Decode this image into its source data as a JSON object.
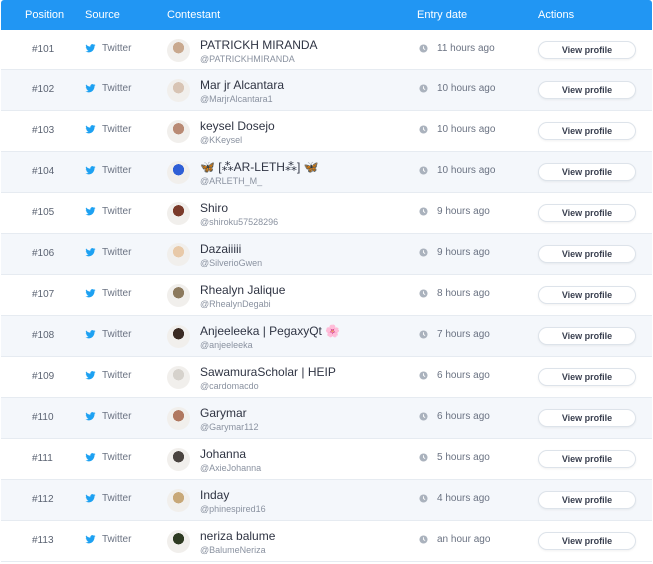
{
  "header": {
    "position": "Position",
    "source": "Source",
    "contestant": "Contestant",
    "entry_date": "Entry date",
    "actions": "Actions"
  },
  "colors": {
    "header_bg": "#2196f3",
    "twitter": "#1da1f2"
  },
  "rows": [
    {
      "position": "#101",
      "source": "Twitter",
      "name": "PATRICKH MIRANDA",
      "handle": "@PATRICKHMIRANDA",
      "date": "11 hours ago",
      "action": "View profile",
      "avatar": "#c9a98f"
    },
    {
      "position": "#102",
      "source": "Twitter",
      "name": "Mar jr Alcantara",
      "handle": "@MarjrAlcantara1",
      "date": "10 hours ago",
      "action": "View profile",
      "avatar": "#d8c4b4"
    },
    {
      "position": "#103",
      "source": "Twitter",
      "name": "keysel Dosejo",
      "handle": "@KKeysel",
      "date": "10 hours ago",
      "action": "View profile",
      "avatar": "#b98a74"
    },
    {
      "position": "#104",
      "source": "Twitter",
      "name": "🦋 [⁂AR-LETH⁂] 🦋",
      "handle": "@ARLETH_M_",
      "date": "10 hours ago",
      "action": "View profile",
      "avatar": "#2f5fd6"
    },
    {
      "position": "#105",
      "source": "Twitter",
      "name": "Shiro",
      "handle": "@shiroku57528296",
      "date": "9 hours ago",
      "action": "View profile",
      "avatar": "#7a3a2a"
    },
    {
      "position": "#106",
      "source": "Twitter",
      "name": "Dazaiiiii",
      "handle": "@SilverioGwen",
      "date": "9 hours ago",
      "action": "View profile",
      "avatar": "#e8c9a8"
    },
    {
      "position": "#107",
      "source": "Twitter",
      "name": "Rhealyn Jalique",
      "handle": "@RhealynDegabi",
      "date": "8 hours ago",
      "action": "View profile",
      "avatar": "#8c7a5e"
    },
    {
      "position": "#108",
      "source": "Twitter",
      "name": "Anjeeleeka | PegaxyQt 🌸",
      "handle": "@anjeeleeka",
      "date": "7 hours ago",
      "action": "View profile",
      "avatar": "#3a2a22"
    },
    {
      "position": "#109",
      "source": "Twitter",
      "name": "SawamuraScholar | HEIP",
      "handle": "@cardomacdo",
      "date": "6 hours ago",
      "action": "View profile",
      "avatar": "#d6d2cc"
    },
    {
      "position": "#110",
      "source": "Twitter",
      "name": "Garymar",
      "handle": "@Garymar112",
      "date": "6 hours ago",
      "action": "View profile",
      "avatar": "#b07860"
    },
    {
      "position": "#111",
      "source": "Twitter",
      "name": "Johanna",
      "handle": "@AxieJohanna",
      "date": "5 hours ago",
      "action": "View profile",
      "avatar": "#4a4440"
    },
    {
      "position": "#112",
      "source": "Twitter",
      "name": "Inday",
      "handle": "@phinespired16",
      "date": "4 hours ago",
      "action": "View profile",
      "avatar": "#c8a878"
    },
    {
      "position": "#113",
      "source": "Twitter",
      "name": "neriza balume",
      "handle": "@BalumeNeriza",
      "date": "an hour ago",
      "action": "View profile",
      "avatar": "#2e3a22"
    }
  ]
}
